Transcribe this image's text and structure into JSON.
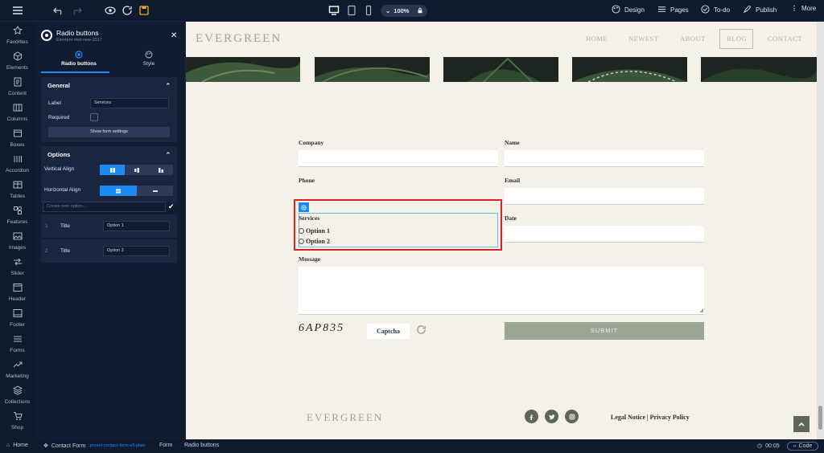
{
  "toolbar": {
    "zoom": "100%",
    "design_label": "Design",
    "pages_label": "Pages",
    "todo_label": "To-do",
    "publish_label": "Publish",
    "more_label": "More"
  },
  "rail": {
    "items": [
      {
        "label": "Favorites",
        "icon": "star-icon"
      },
      {
        "label": "Elements",
        "icon": "cube-icon"
      },
      {
        "label": "Content",
        "icon": "content-icon"
      },
      {
        "label": "Columns",
        "icon": "columns-icon"
      },
      {
        "label": "Boxes",
        "icon": "box-icon"
      },
      {
        "label": "Accordion",
        "icon": "accordion-icon"
      },
      {
        "label": "Tables",
        "icon": "table-icon"
      },
      {
        "label": "Features",
        "icon": "features-icon"
      },
      {
        "label": "Images",
        "icon": "image-icon"
      },
      {
        "label": "Slider",
        "icon": "slider-icon"
      },
      {
        "label": "Header",
        "icon": "header-icon"
      },
      {
        "label": "Footer",
        "icon": "footer-icon"
      },
      {
        "label": "Forms",
        "icon": "forms-icon"
      },
      {
        "label": "Marketing",
        "icon": "marketing-icon"
      },
      {
        "label": "Collections",
        "icon": "collections-icon"
      },
      {
        "label": "Shop",
        "icon": "cart-icon"
      }
    ]
  },
  "panel": {
    "title": "Radio buttons",
    "subtitle": "Element #ed-new-3317",
    "tab_radio": "Radio buttons",
    "tab_style": "Style",
    "general": {
      "header": "General",
      "label_label": "Label",
      "label_value": "Services",
      "required_label": "Required",
      "show_settings": "Show form settings"
    },
    "options": {
      "header": "Options",
      "vertical_align": "Vertical Align",
      "horizontal_align": "Horizontal Align",
      "new_option_placeholder": "Create new option...",
      "rows": [
        {
          "num": "1",
          "title_label": "Title",
          "value": "Option 1"
        },
        {
          "num": "2",
          "title_label": "Title",
          "value": "Option 2"
        }
      ]
    }
  },
  "site": {
    "logo": "EVERGREEN",
    "nav": [
      "HOME",
      "NEWEST",
      "ABOUT",
      "BLOG",
      "CONTACT"
    ],
    "active_nav": "BLOG",
    "form": {
      "company": "Company",
      "name": "Name",
      "phone": "Phone",
      "email": "Email",
      "services": "Services",
      "option1": "Option 1",
      "option2": "Option 2",
      "date": "Date",
      "message": "Message",
      "captcha_text": "6AP835",
      "captcha_button": "Captcha",
      "submit": "SUBMIT"
    },
    "footer": {
      "logo": "EVERGREEN",
      "legal": "Legal Notice",
      "privacy": "Privacy Policy"
    }
  },
  "bottombar": {
    "home": "Home",
    "contact_form": "Contact Form",
    "preset": ".preset-contact-form-v3-plain",
    "form": "Form",
    "radio": "Radio buttons",
    "time": "00:05",
    "code": "Code"
  },
  "colors": {
    "accent": "#1d8bf0",
    "selection": "#e02020",
    "sage": "#9aa596"
  }
}
